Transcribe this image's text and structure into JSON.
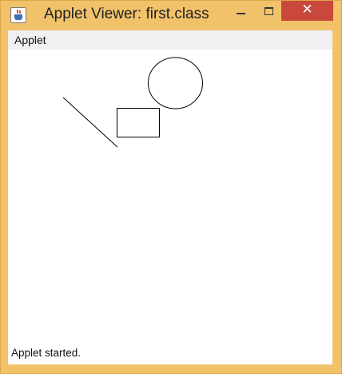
{
  "window": {
    "title": "Applet Viewer: first.class",
    "icon": "java-cup-icon",
    "controls": {
      "minimize": "minimize-icon",
      "maximize": "maximize-icon",
      "close": "close-icon",
      "close_glyph": "✕"
    },
    "frame_color": "#f1c26a",
    "close_color": "#c9483b"
  },
  "menubar": {
    "items": [
      {
        "label": "Applet"
      }
    ]
  },
  "canvas": {
    "shapes": [
      "line",
      "rectangle",
      "oval"
    ],
    "stroke_color": "#000000"
  },
  "status": {
    "text": "Applet started."
  }
}
